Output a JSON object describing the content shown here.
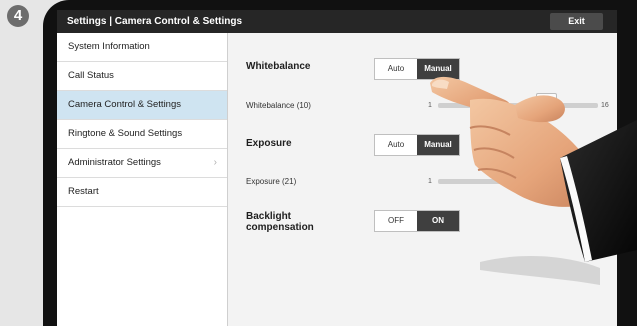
{
  "step_badge": "4",
  "titlebar": {
    "title": "Settings  |  Camera Control & Settings",
    "exit_label": "Exit"
  },
  "sidebar": {
    "items": [
      {
        "label": "System Information",
        "active": false
      },
      {
        "label": "Call Status",
        "active": false
      },
      {
        "label": "Camera Control & Settings",
        "active": true
      },
      {
        "label": "Ringtone & Sound Settings",
        "active": false
      },
      {
        "label": "Administrator Settings",
        "active": false,
        "chevron": "›"
      },
      {
        "label": "Restart",
        "active": false
      }
    ]
  },
  "whitebalance": {
    "label": "Whitebalance",
    "options": [
      "Auto",
      "Manual"
    ],
    "selected": "Manual",
    "slider_label": "Whitebalance (10)",
    "slider_min": "1",
    "slider_max": "16",
    "slider_value": 10
  },
  "exposure": {
    "label": "Exposure",
    "options": [
      "Auto",
      "Manual"
    ],
    "selected": "Manual",
    "slider_label": "Exposure (21)",
    "slider_min": "1",
    "slider_value": 21
  },
  "backlight": {
    "label_line1": "Backlight",
    "label_line2": "compensation",
    "options": [
      "OFF",
      "ON"
    ],
    "selected": "ON"
  },
  "colors": {
    "titlebar": "#262626",
    "active_item": "#cfe4f1",
    "selected_option": "#3f3f3f"
  }
}
